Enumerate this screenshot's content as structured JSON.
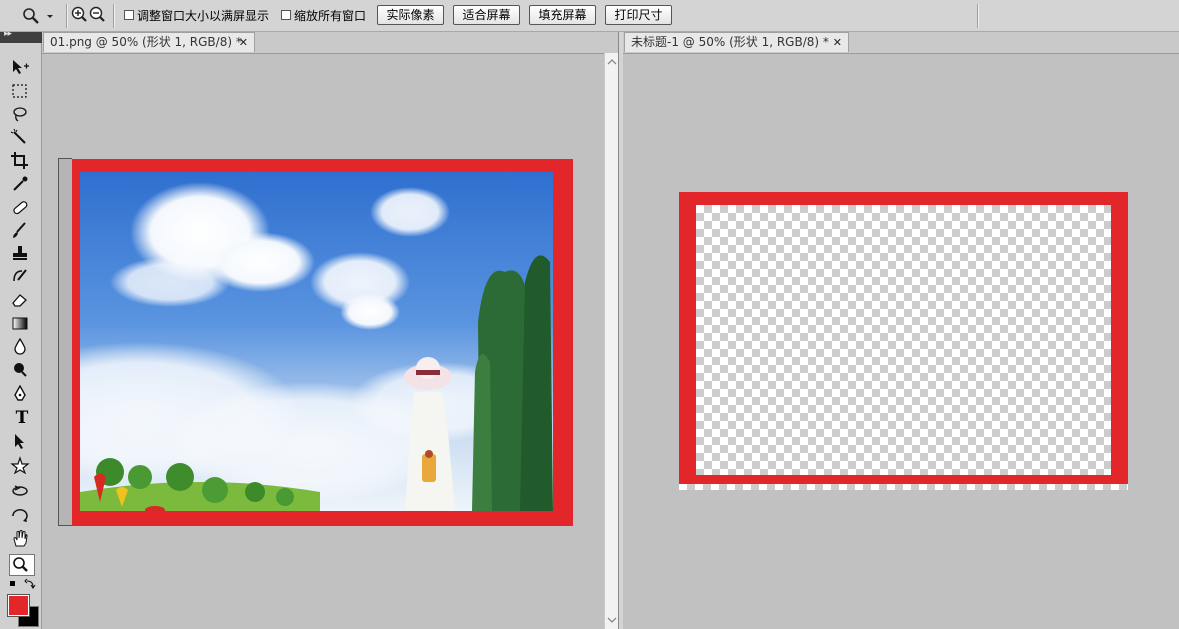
{
  "options_bar": {
    "tool_icon": "zoom-tool-icon",
    "zoom_in_icon": "zoom-in-icon",
    "zoom_out_icon": "zoom-out-icon",
    "resize_windows_label": "调整窗口大小以满屏显示",
    "zoom_all_windows_label": "缩放所有窗口",
    "resize_windows_checked": false,
    "zoom_all_windows_checked": false,
    "buttons": [
      "实际像素",
      "适合屏幕",
      "填充屏幕",
      "打印尺寸"
    ]
  },
  "documents": [
    {
      "tab_title": "01.png @ 50% (形状 1, RGB/8) *",
      "close": "✕"
    },
    {
      "tab_title": "未标题-1 @ 50% (形状 1, RGB/8) *",
      "close": "✕"
    }
  ],
  "toolbox": {
    "grip": "▸▸",
    "tools": [
      "move-tool-icon",
      "marquee-tool-icon",
      "lasso-tool-icon",
      "magic-wand-tool-icon",
      "crop-tool-icon",
      "eyedropper-tool-icon",
      "healing-brush-tool-icon",
      "brush-tool-icon",
      "clone-stamp-tool-icon",
      "history-brush-tool-icon",
      "eraser-tool-icon",
      "gradient-tool-icon",
      "blur-tool-icon",
      "dodge-tool-icon",
      "pen-tool-icon",
      "type-tool-icon",
      "path-selection-tool-icon",
      "custom-shape-tool-icon",
      "3d-rotate-tool-icon",
      "3d-orbit-tool-icon",
      "hand-tool-icon",
      "zoom-tool-icon"
    ],
    "active_tool": "zoom-tool-icon",
    "type_tool_glyph": "T",
    "foreground_color": "#e3262a",
    "background_color": "#000000"
  },
  "colors": {
    "frame_red": "#e3262a",
    "workspace_gray": "#c1c1c1",
    "sky_blue": "#3f7fd6"
  }
}
